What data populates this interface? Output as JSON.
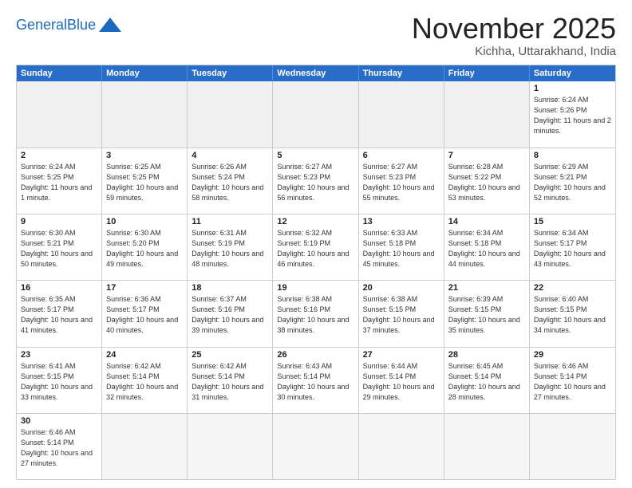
{
  "header": {
    "logo_general": "General",
    "logo_blue": "Blue",
    "month_title": "November 2025",
    "location": "Kichha, Uttarakhand, India"
  },
  "weekdays": [
    "Sunday",
    "Monday",
    "Tuesday",
    "Wednesday",
    "Thursday",
    "Friday",
    "Saturday"
  ],
  "weeks": [
    [
      {
        "day": "",
        "sunrise": "",
        "sunset": "",
        "daylight": "",
        "empty": true
      },
      {
        "day": "",
        "sunrise": "",
        "sunset": "",
        "daylight": "",
        "empty": true
      },
      {
        "day": "",
        "sunrise": "",
        "sunset": "",
        "daylight": "",
        "empty": true
      },
      {
        "day": "",
        "sunrise": "",
        "sunset": "",
        "daylight": "",
        "empty": true
      },
      {
        "day": "",
        "sunrise": "",
        "sunset": "",
        "daylight": "",
        "empty": true
      },
      {
        "day": "",
        "sunrise": "",
        "sunset": "",
        "daylight": "",
        "empty": true
      },
      {
        "day": "1",
        "sunrise": "Sunrise: 6:24 AM",
        "sunset": "Sunset: 5:26 PM",
        "daylight": "Daylight: 11 hours and 2 minutes.",
        "empty": false
      }
    ],
    [
      {
        "day": "2",
        "sunrise": "Sunrise: 6:24 AM",
        "sunset": "Sunset: 5:25 PM",
        "daylight": "Daylight: 11 hours and 1 minute.",
        "empty": false
      },
      {
        "day": "3",
        "sunrise": "Sunrise: 6:25 AM",
        "sunset": "Sunset: 5:25 PM",
        "daylight": "Daylight: 10 hours and 59 minutes.",
        "empty": false
      },
      {
        "day": "4",
        "sunrise": "Sunrise: 6:26 AM",
        "sunset": "Sunset: 5:24 PM",
        "daylight": "Daylight: 10 hours and 58 minutes.",
        "empty": false
      },
      {
        "day": "5",
        "sunrise": "Sunrise: 6:27 AM",
        "sunset": "Sunset: 5:23 PM",
        "daylight": "Daylight: 10 hours and 56 minutes.",
        "empty": false
      },
      {
        "day": "6",
        "sunrise": "Sunrise: 6:27 AM",
        "sunset": "Sunset: 5:23 PM",
        "daylight": "Daylight: 10 hours and 55 minutes.",
        "empty": false
      },
      {
        "day": "7",
        "sunrise": "Sunrise: 6:28 AM",
        "sunset": "Sunset: 5:22 PM",
        "daylight": "Daylight: 10 hours and 53 minutes.",
        "empty": false
      },
      {
        "day": "8",
        "sunrise": "Sunrise: 6:29 AM",
        "sunset": "Sunset: 5:21 PM",
        "daylight": "Daylight: 10 hours and 52 minutes.",
        "empty": false
      }
    ],
    [
      {
        "day": "9",
        "sunrise": "Sunrise: 6:30 AM",
        "sunset": "Sunset: 5:21 PM",
        "daylight": "Daylight: 10 hours and 50 minutes.",
        "empty": false
      },
      {
        "day": "10",
        "sunrise": "Sunrise: 6:30 AM",
        "sunset": "Sunset: 5:20 PM",
        "daylight": "Daylight: 10 hours and 49 minutes.",
        "empty": false
      },
      {
        "day": "11",
        "sunrise": "Sunrise: 6:31 AM",
        "sunset": "Sunset: 5:19 PM",
        "daylight": "Daylight: 10 hours and 48 minutes.",
        "empty": false
      },
      {
        "day": "12",
        "sunrise": "Sunrise: 6:32 AM",
        "sunset": "Sunset: 5:19 PM",
        "daylight": "Daylight: 10 hours and 46 minutes.",
        "empty": false
      },
      {
        "day": "13",
        "sunrise": "Sunrise: 6:33 AM",
        "sunset": "Sunset: 5:18 PM",
        "daylight": "Daylight: 10 hours and 45 minutes.",
        "empty": false
      },
      {
        "day": "14",
        "sunrise": "Sunrise: 6:34 AM",
        "sunset": "Sunset: 5:18 PM",
        "daylight": "Daylight: 10 hours and 44 minutes.",
        "empty": false
      },
      {
        "day": "15",
        "sunrise": "Sunrise: 6:34 AM",
        "sunset": "Sunset: 5:17 PM",
        "daylight": "Daylight: 10 hours and 43 minutes.",
        "empty": false
      }
    ],
    [
      {
        "day": "16",
        "sunrise": "Sunrise: 6:35 AM",
        "sunset": "Sunset: 5:17 PM",
        "daylight": "Daylight: 10 hours and 41 minutes.",
        "empty": false
      },
      {
        "day": "17",
        "sunrise": "Sunrise: 6:36 AM",
        "sunset": "Sunset: 5:17 PM",
        "daylight": "Daylight: 10 hours and 40 minutes.",
        "empty": false
      },
      {
        "day": "18",
        "sunrise": "Sunrise: 6:37 AM",
        "sunset": "Sunset: 5:16 PM",
        "daylight": "Daylight: 10 hours and 39 minutes.",
        "empty": false
      },
      {
        "day": "19",
        "sunrise": "Sunrise: 6:38 AM",
        "sunset": "Sunset: 5:16 PM",
        "daylight": "Daylight: 10 hours and 38 minutes.",
        "empty": false
      },
      {
        "day": "20",
        "sunrise": "Sunrise: 6:38 AM",
        "sunset": "Sunset: 5:15 PM",
        "daylight": "Daylight: 10 hours and 37 minutes.",
        "empty": false
      },
      {
        "day": "21",
        "sunrise": "Sunrise: 6:39 AM",
        "sunset": "Sunset: 5:15 PM",
        "daylight": "Daylight: 10 hours and 35 minutes.",
        "empty": false
      },
      {
        "day": "22",
        "sunrise": "Sunrise: 6:40 AM",
        "sunset": "Sunset: 5:15 PM",
        "daylight": "Daylight: 10 hours and 34 minutes.",
        "empty": false
      }
    ],
    [
      {
        "day": "23",
        "sunrise": "Sunrise: 6:41 AM",
        "sunset": "Sunset: 5:15 PM",
        "daylight": "Daylight: 10 hours and 33 minutes.",
        "empty": false
      },
      {
        "day": "24",
        "sunrise": "Sunrise: 6:42 AM",
        "sunset": "Sunset: 5:14 PM",
        "daylight": "Daylight: 10 hours and 32 minutes.",
        "empty": false
      },
      {
        "day": "25",
        "sunrise": "Sunrise: 6:42 AM",
        "sunset": "Sunset: 5:14 PM",
        "daylight": "Daylight: 10 hours and 31 minutes.",
        "empty": false
      },
      {
        "day": "26",
        "sunrise": "Sunrise: 6:43 AM",
        "sunset": "Sunset: 5:14 PM",
        "daylight": "Daylight: 10 hours and 30 minutes.",
        "empty": false
      },
      {
        "day": "27",
        "sunrise": "Sunrise: 6:44 AM",
        "sunset": "Sunset: 5:14 PM",
        "daylight": "Daylight: 10 hours and 29 minutes.",
        "empty": false
      },
      {
        "day": "28",
        "sunrise": "Sunrise: 6:45 AM",
        "sunset": "Sunset: 5:14 PM",
        "daylight": "Daylight: 10 hours and 28 minutes.",
        "empty": false
      },
      {
        "day": "29",
        "sunrise": "Sunrise: 6:46 AM",
        "sunset": "Sunset: 5:14 PM",
        "daylight": "Daylight: 10 hours and 27 minutes.",
        "empty": false
      }
    ],
    [
      {
        "day": "30",
        "sunrise": "Sunrise: 6:46 AM",
        "sunset": "Sunset: 5:14 PM",
        "daylight": "Daylight: 10 hours and 27 minutes.",
        "empty": false
      },
      {
        "day": "",
        "sunrise": "",
        "sunset": "",
        "daylight": "",
        "empty": true
      },
      {
        "day": "",
        "sunrise": "",
        "sunset": "",
        "daylight": "",
        "empty": true
      },
      {
        "day": "",
        "sunrise": "",
        "sunset": "",
        "daylight": "",
        "empty": true
      },
      {
        "day": "",
        "sunrise": "",
        "sunset": "",
        "daylight": "",
        "empty": true
      },
      {
        "day": "",
        "sunrise": "",
        "sunset": "",
        "daylight": "",
        "empty": true
      },
      {
        "day": "",
        "sunrise": "",
        "sunset": "",
        "daylight": "",
        "empty": true
      }
    ]
  ]
}
